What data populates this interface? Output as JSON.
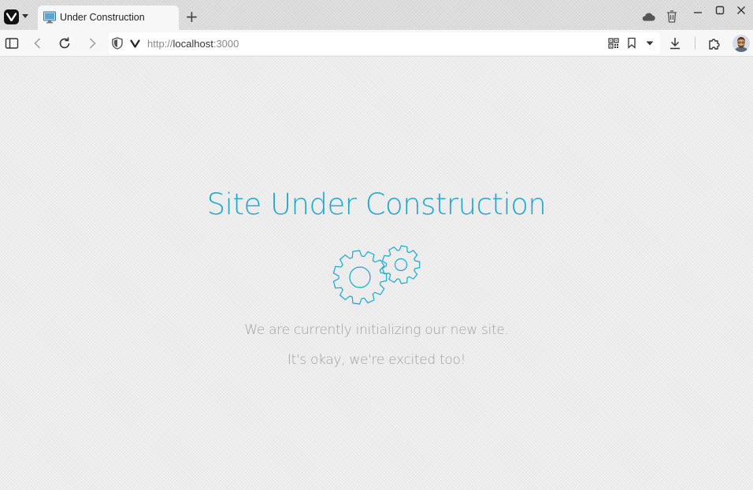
{
  "browser": {
    "tab": {
      "title": "Under Construction"
    },
    "new_tab_label": "+",
    "address": {
      "scheme": "http://",
      "host": "localhost",
      "port": ":3000"
    },
    "accent": "#1ba7d0"
  },
  "page": {
    "heading": "Site Under Construction",
    "message_line_1": "We are currently initializing our new site.",
    "message_line_2": "It's okay, we're excited too!",
    "icon": "gears-icon"
  }
}
